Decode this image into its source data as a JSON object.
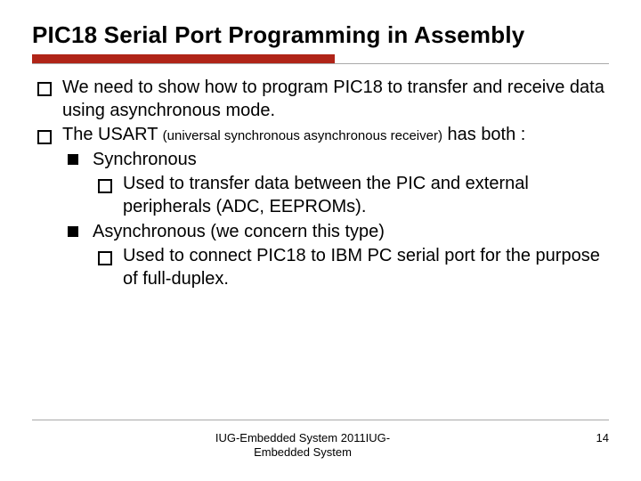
{
  "title": "PIC18 Serial Port Programming in Assembly",
  "bullets": {
    "b1": "We need to show how to program PIC18 to transfer and receive data using asynchronous mode.",
    "b2a": "The USART ",
    "b2b": "(universal synchronous asynchronous receiver)",
    "b2c": " has both :",
    "b2_1": "Synchronous",
    "b2_1_1": "Used to transfer data between the PIC and external peripherals (ADC, EEPROMs).",
    "b2_2": "Asynchronous (we concern this type)",
    "b2_2_1": "Used to connect PIC18 to IBM PC serial port for the purpose of full-duplex."
  },
  "footer": {
    "center1": "IUG-Embedded System 2011IUG-",
    "center2": "Embedded System",
    "page": "14"
  }
}
